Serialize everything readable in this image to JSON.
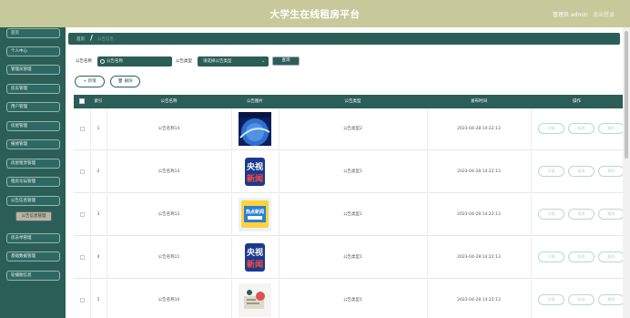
{
  "header": {
    "title": "大学生在线租房平台",
    "user": "管理员 admin",
    "logout": "退出登录"
  },
  "sidebar": {
    "items": [
      {
        "label": "首页"
      },
      {
        "label": "个人中心"
      },
      {
        "label": "管理员管理"
      },
      {
        "label": "房东管理"
      },
      {
        "label": "用户管理"
      },
      {
        "label": "房屋管理"
      },
      {
        "label": "报修管理"
      },
      {
        "label": "房屋租赁管理"
      },
      {
        "label": "租房论坛管理"
      },
      {
        "label": "公告信息管理"
      },
      {
        "label": "公告信息管理"
      },
      {
        "label": "房东举管理"
      },
      {
        "label": "基础数据管理"
      },
      {
        "label": "轮播图信息"
      }
    ]
  },
  "breadcrumb": {
    "home": "首页",
    "separator": "/",
    "current": "公告信息"
  },
  "filters": {
    "name_label": "公告名称",
    "name_placeholder": "公告名称",
    "type_label": "公告类型",
    "type_select": "请选择公告类型",
    "query_button": "查询"
  },
  "actions": {
    "add": "+ 新增",
    "delete": "删除"
  },
  "table": {
    "headers": [
      "索引",
      "公告名称",
      "公告图片",
      "公告类型",
      "发布时间",
      "操作"
    ],
    "rows": [
      {
        "index": "1",
        "name": "公告名称14",
        "image": "blue-globe-image",
        "type": "公告类型2",
        "time": "2023-04-28 14:22:13"
      },
      {
        "index": "2",
        "name": "公告名称13",
        "image": "cctv-news-logo",
        "type": "公告类型1",
        "time": "2023-04-28 14:22:13"
      },
      {
        "index": "3",
        "name": "公告名称12",
        "image": "news-badge-image",
        "type": "公告类型1",
        "time": "2023-04-28 14:22:13"
      },
      {
        "index": "4",
        "name": "公告名称11",
        "image": "cctv-news-logo",
        "type": "公告类型1",
        "time": "2023-04-28 14:22:13"
      },
      {
        "index": "5",
        "name": "公告名称10",
        "image": "notice-image",
        "type": "公告类型1",
        "time": "2023-04-28 14:22:13"
      }
    ],
    "row_actions": [
      "详情",
      "修改",
      "删除"
    ]
  },
  "logo_text": {
    "cctv_top": "央视",
    "cctv_bottom": "新闻",
    "badge": "热点新闻"
  },
  "colors": {
    "primary": "#2c5e58",
    "topbar": "#c7c99a",
    "action_outline": "#b8d8cf"
  }
}
